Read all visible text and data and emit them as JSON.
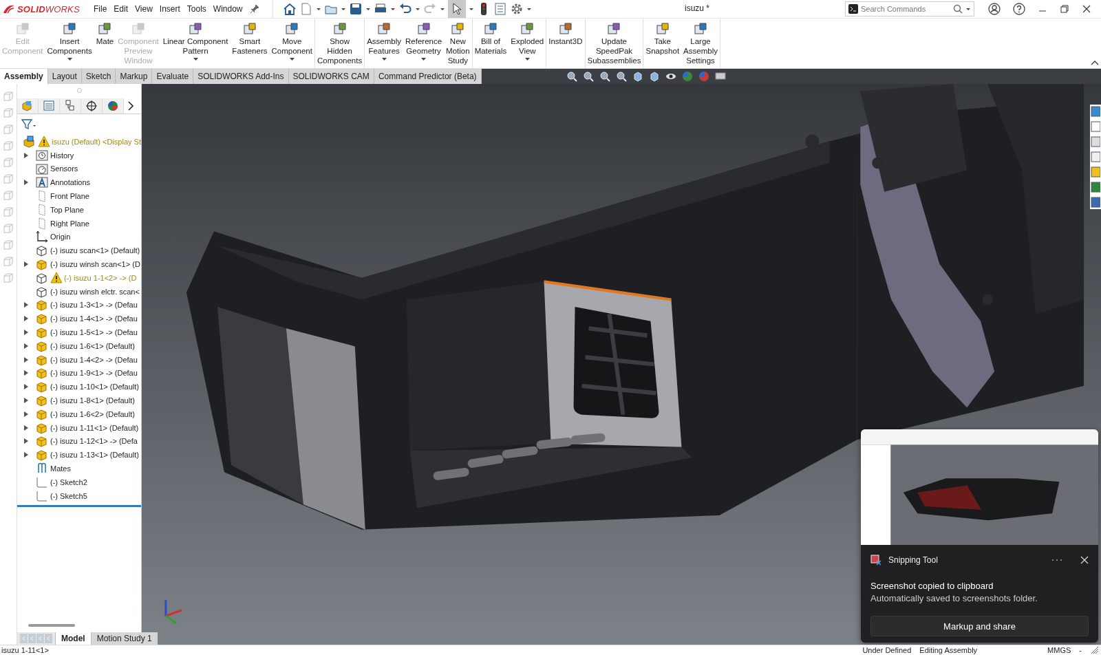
{
  "app": {
    "logo": "**SOLID**WORKS"
  },
  "menu": [
    "File",
    "Edit",
    "View",
    "Insert",
    "Tools",
    "Window"
  ],
  "title": "isuzu *",
  "search": {
    "placeholder": "Search Commands"
  },
  "ribbon": [
    [
      {
        "label": "Edit\nComponent",
        "disabled": true,
        "has_menu": false
      },
      {
        "label": "Insert\nComponents",
        "disabled": false,
        "has_menu": true
      },
      {
        "label": "Mate",
        "disabled": false,
        "has_menu": false
      },
      {
        "label": "Component\nPreview\nWindow",
        "disabled": true,
        "has_menu": false
      },
      {
        "label": "Linear Component\nPattern",
        "disabled": false,
        "has_menu": true
      },
      {
        "label": "Smart\nFasteners",
        "disabled": false,
        "has_menu": false
      },
      {
        "label": "Move\nComponent",
        "disabled": false,
        "has_menu": true
      }
    ],
    [
      {
        "label": "Show\nHidden\nComponents",
        "disabled": false,
        "has_menu": false
      }
    ],
    [
      {
        "label": "Assembly\nFeatures",
        "disabled": false,
        "has_menu": true
      },
      {
        "label": "Reference\nGeometry",
        "disabled": false,
        "has_menu": true
      },
      {
        "label": "New\nMotion\nStudy",
        "disabled": false,
        "has_menu": false
      }
    ],
    [
      {
        "label": "Bill of\nMaterials",
        "disabled": false,
        "has_menu": false
      },
      {
        "label": "Exploded\nView",
        "disabled": false,
        "has_menu": true
      }
    ],
    [
      {
        "label": "Instant3D",
        "disabled": false,
        "has_menu": false
      }
    ],
    [
      {
        "label": "Update\nSpeedPak\nSubassemblies",
        "disabled": false,
        "has_menu": false
      }
    ],
    [
      {
        "label": "Take\nSnapshot",
        "disabled": false,
        "has_menu": false
      },
      {
        "label": "Large\nAssembly\nSettings",
        "disabled": false,
        "has_menu": false
      }
    ]
  ],
  "command_tabs": [
    {
      "label": "Assembly",
      "selected": true
    },
    {
      "label": "Layout",
      "selected": false
    },
    {
      "label": "Sketch",
      "selected": false
    },
    {
      "label": "Markup",
      "selected": false
    },
    {
      "label": "Evaluate",
      "selected": false
    },
    {
      "label": "SOLIDWORKS Add-Ins",
      "selected": false
    },
    {
      "label": "SOLIDWORKS CAM",
      "selected": false
    },
    {
      "label": "Command Predictor (Beta)",
      "selected": false
    }
  ],
  "tree": {
    "label": "isuzu (Default) <Display St",
    "kind": "assembly",
    "warning": true,
    "children": [
      {
        "label": "History",
        "kind": "history",
        "expander": true,
        "warning": false
      },
      {
        "label": "Sensors",
        "kind": "sensors",
        "expander": false,
        "warning": false
      },
      {
        "label": "Annotations",
        "kind": "annotations",
        "expander": true,
        "warning": false
      },
      {
        "label": "Front Plane",
        "kind": "plane",
        "expander": false,
        "warning": false
      },
      {
        "label": "Top Plane",
        "kind": "plane",
        "expander": false,
        "warning": false
      },
      {
        "label": "Right Plane",
        "kind": "plane",
        "expander": false,
        "warning": false
      },
      {
        "label": "Origin",
        "kind": "origin",
        "expander": false,
        "warning": false
      },
      {
        "label": "(-) isuzu scan<1> (Default)",
        "kind": "part-outline",
        "expander": false,
        "warning": false
      },
      {
        "label": "(-) isuzu winsh scan<1> (D",
        "kind": "part",
        "expander": true,
        "warning": false
      },
      {
        "label": "(-) isuzu 1-1<2> -> (D",
        "kind": "part-outline",
        "expander": false,
        "warning": true
      },
      {
        "label": "(-) isuzu winsh elctr. scan<",
        "kind": "part-outline",
        "expander": false,
        "warning": false
      },
      {
        "label": "(-) isuzu 1-3<1> -> (Defau",
        "kind": "part",
        "expander": true,
        "warning": false
      },
      {
        "label": "(-) isuzu 1-4<1> -> (Defau",
        "kind": "part",
        "expander": true,
        "warning": false
      },
      {
        "label": "(-) isuzu 1-5<1> -> (Defau",
        "kind": "part",
        "expander": true,
        "warning": false
      },
      {
        "label": "(-) isuzu 1-6<1> (Default)",
        "kind": "part",
        "expander": true,
        "warning": false
      },
      {
        "label": "(-) isuzu 1-4<2> -> (Defau",
        "kind": "part",
        "expander": true,
        "warning": false
      },
      {
        "label": "(-) isuzu 1-9<1> -> (Defau",
        "kind": "part",
        "expander": true,
        "warning": false
      },
      {
        "label": "(-) isuzu 1-10<1> (Default)",
        "kind": "part",
        "expander": true,
        "warning": false
      },
      {
        "label": "(-) isuzu 1-8<1> (Default)",
        "kind": "part",
        "expander": true,
        "warning": false
      },
      {
        "label": "(-) isuzu 1-6<2> (Default)",
        "kind": "part",
        "expander": true,
        "warning": false
      },
      {
        "label": "(-) isuzu 1-11<1> (Default)",
        "kind": "part",
        "expander": true,
        "warning": false
      },
      {
        "label": "(-) isuzu 1-12<1> -> (Defa",
        "kind": "part",
        "expander": true,
        "warning": false
      },
      {
        "label": "(-) isuzu 1-13<1> (Default)",
        "kind": "part",
        "expander": true,
        "warning": false
      },
      {
        "label": "Mates",
        "kind": "mates",
        "expander": false,
        "warning": false
      },
      {
        "label": "(-) Sketch2",
        "kind": "sketch",
        "expander": false,
        "warning": false
      },
      {
        "label": "(-) Sketch5",
        "kind": "sketch",
        "expander": false,
        "warning": false
      }
    ]
  },
  "bottom_tabs": [
    {
      "label": "Model",
      "selected": true
    },
    {
      "label": "Motion Study 1",
      "selected": false
    }
  ],
  "status_bar": {
    "left": "isuzu 1-11<1>",
    "items": [
      "Under Defined",
      "Editing Assembly",
      "MMGS",
      "-"
    ]
  },
  "toast": {
    "app": "Snipping Tool",
    "title": "Screenshot copied to clipboard",
    "body": "Automatically saved to screenshots folder.",
    "button": "Markup and share"
  }
}
